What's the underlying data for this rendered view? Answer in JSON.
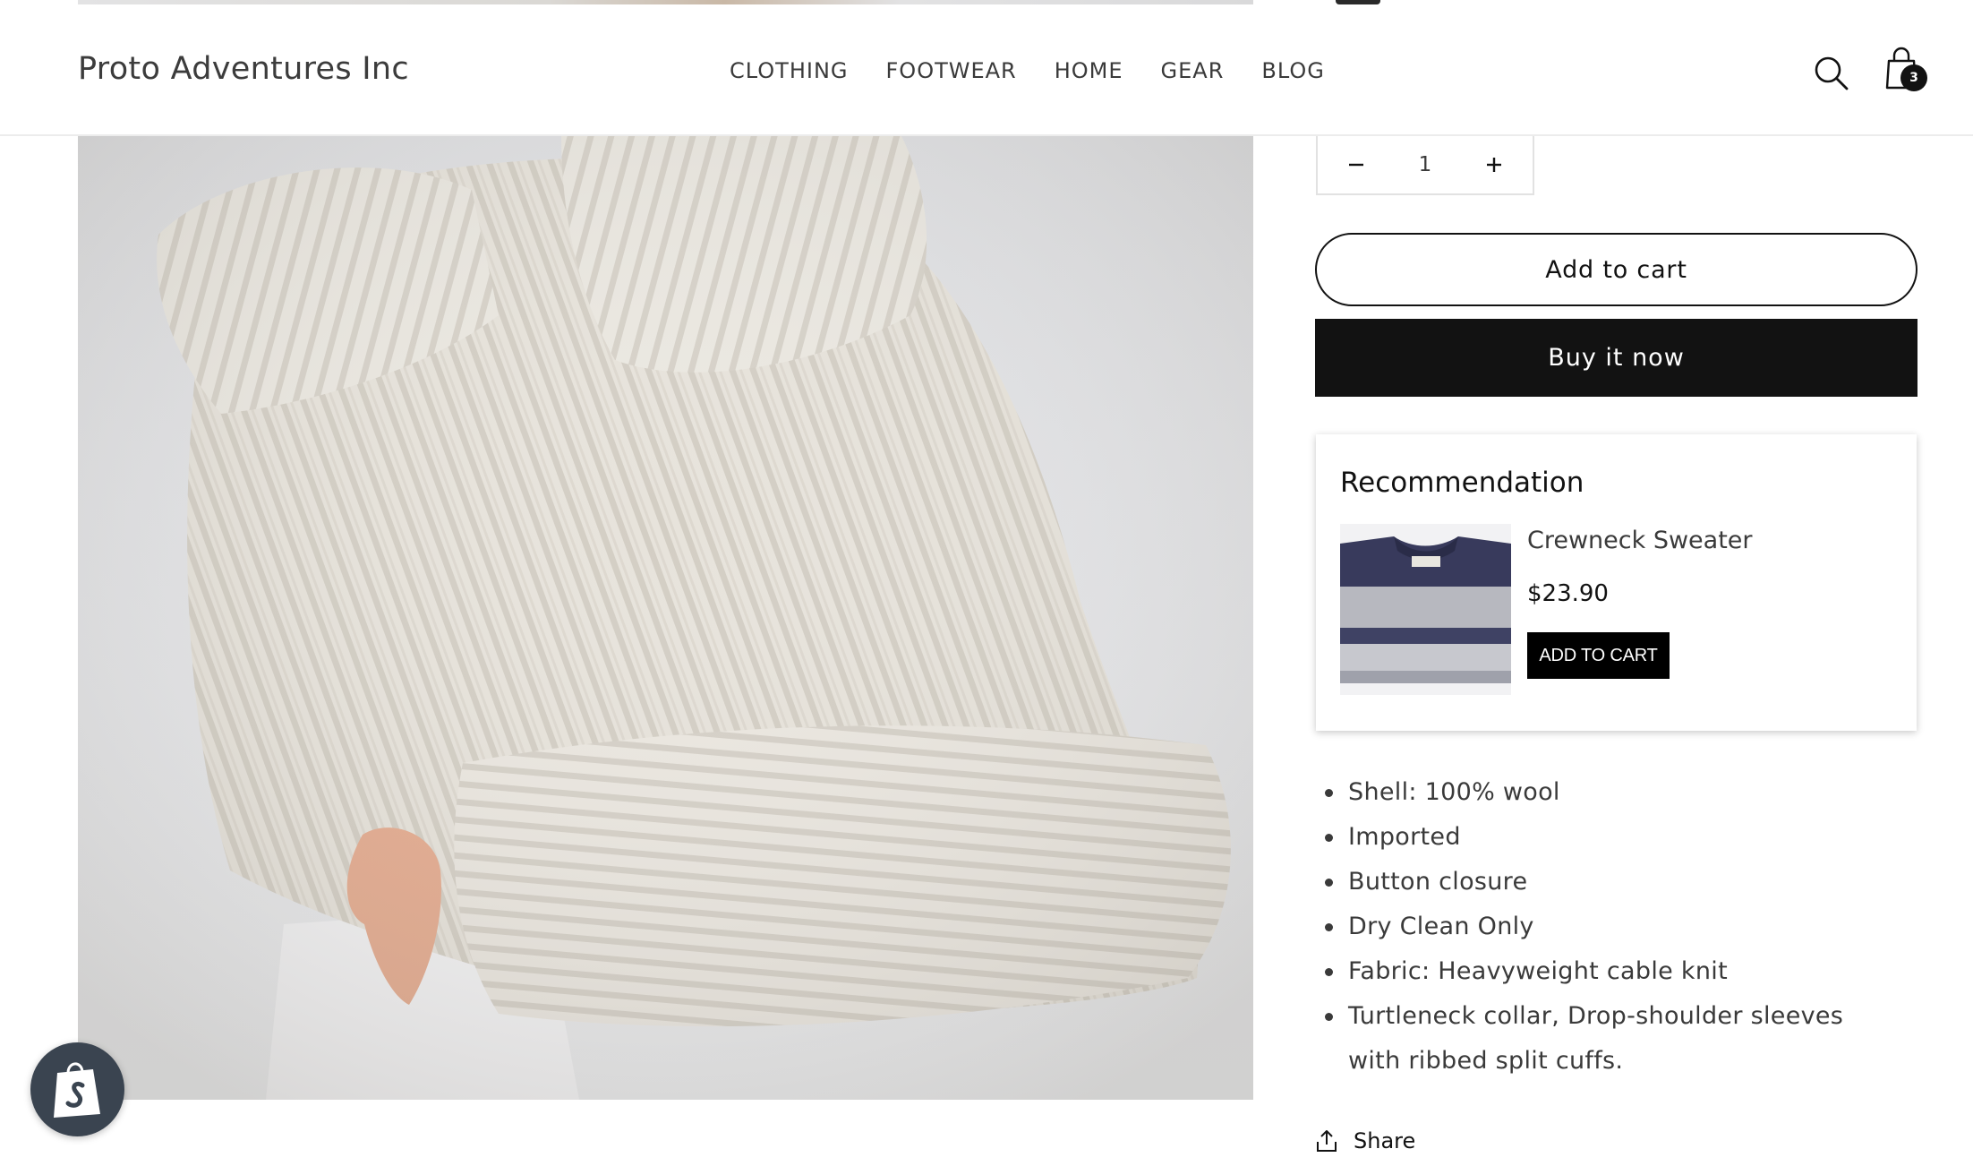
{
  "header": {
    "store_name": "Proto Adventures Inc",
    "nav": [
      "CLOTHING",
      "FOOTWEAR",
      "HOME",
      "GEAR",
      "BLOG"
    ],
    "search_icon": "search-icon",
    "cart_icon": "shopping-bag-icon",
    "cart_count": "3"
  },
  "product": {
    "image_icon": "product-photo",
    "quantity": "1",
    "add_to_cart_label": "Add to cart",
    "buy_now_label": "Buy it now",
    "features": [
      "Shell: 100% wool",
      "Imported",
      "Button closure",
      "Dry Clean Only",
      "Fabric: Heavyweight cable knit",
      "Turtleneck collar, Drop-shoulder sleeves with ribbed split cuffs."
    ],
    "share_label": "Share"
  },
  "recommendation": {
    "title": "Recommendation",
    "item_name": "Crewneck Sweater",
    "item_price": "$23.90",
    "button_label": "ADD TO CART"
  },
  "colors": {
    "primary": "#121212",
    "background": "#ffffff",
    "text_muted": "#3a3a3a",
    "shopify_bubble": "#3a4450"
  }
}
